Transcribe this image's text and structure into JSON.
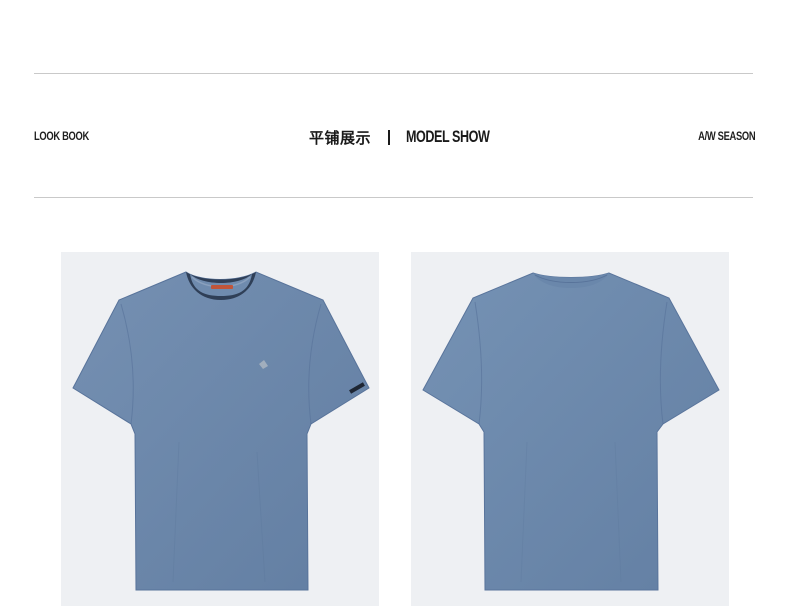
{
  "header": {
    "left_label": "LOOK BOOK",
    "title_cn": "平铺展示",
    "title_en": "MODEL SHOW",
    "right_label": "A/W SEASON"
  },
  "photos": [
    {
      "view": "front",
      "subject": "t-shirt-front"
    },
    {
      "view": "back",
      "subject": "t-shirt-back"
    }
  ],
  "colors": {
    "shirt": "#6b87aa",
    "shirt_shade": "#5e7a9d",
    "photo_bg": "#eef0f3",
    "rule": "#c9c9c9"
  }
}
